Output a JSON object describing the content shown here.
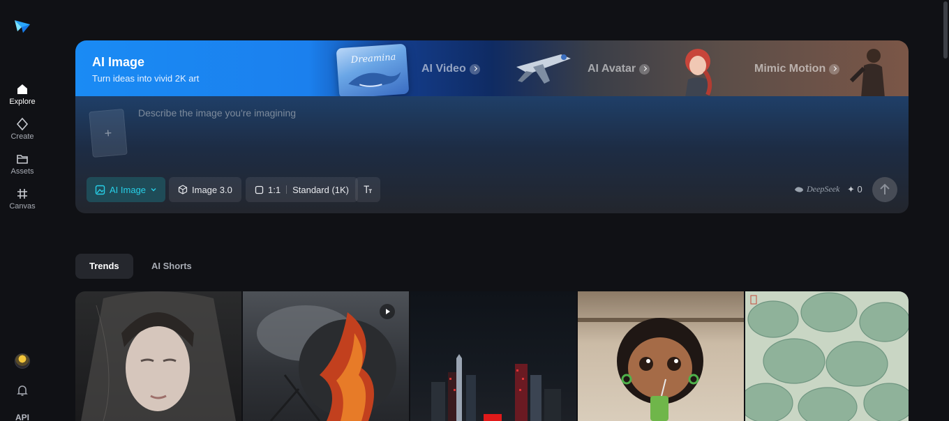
{
  "sidebar": {
    "logo_icon": "paper-plane-logo",
    "items": [
      {
        "label": "Explore",
        "icon": "home-icon",
        "active": true
      },
      {
        "label": "Create",
        "icon": "diamond-sparkle-icon",
        "active": false
      },
      {
        "label": "Assets",
        "icon": "folder-icon",
        "active": false
      },
      {
        "label": "Canvas",
        "icon": "hash-frame-icon",
        "active": false
      }
    ],
    "api_label": "API"
  },
  "banner": {
    "title": "AI Image",
    "subtitle": "Turn ideas into vivid 2K art",
    "tiles": [
      {
        "label": "AI Video"
      },
      {
        "label": "AI Avatar"
      },
      {
        "label": "Mimic Motion"
      }
    ],
    "brand_script": "Dreamina"
  },
  "prompt": {
    "placeholder": "Describe the image you're imagining",
    "value": "",
    "upload_symbol": "+"
  },
  "toolbar": {
    "type_label": "AI Image",
    "model_label": "Image 3.0",
    "ratio_label": "1:1",
    "resolution_label": "Standard (1K)",
    "deepseek_label": "DeepSeek",
    "credits": "0",
    "credit_symbol": "✦"
  },
  "tabs": [
    {
      "label": "Trends",
      "active": true
    },
    {
      "label": "AI Shorts",
      "active": false
    }
  ],
  "colors": {
    "accent_cyan": "#27d0e8",
    "banner_blue": "#1a8bf4",
    "background": "#101115"
  }
}
